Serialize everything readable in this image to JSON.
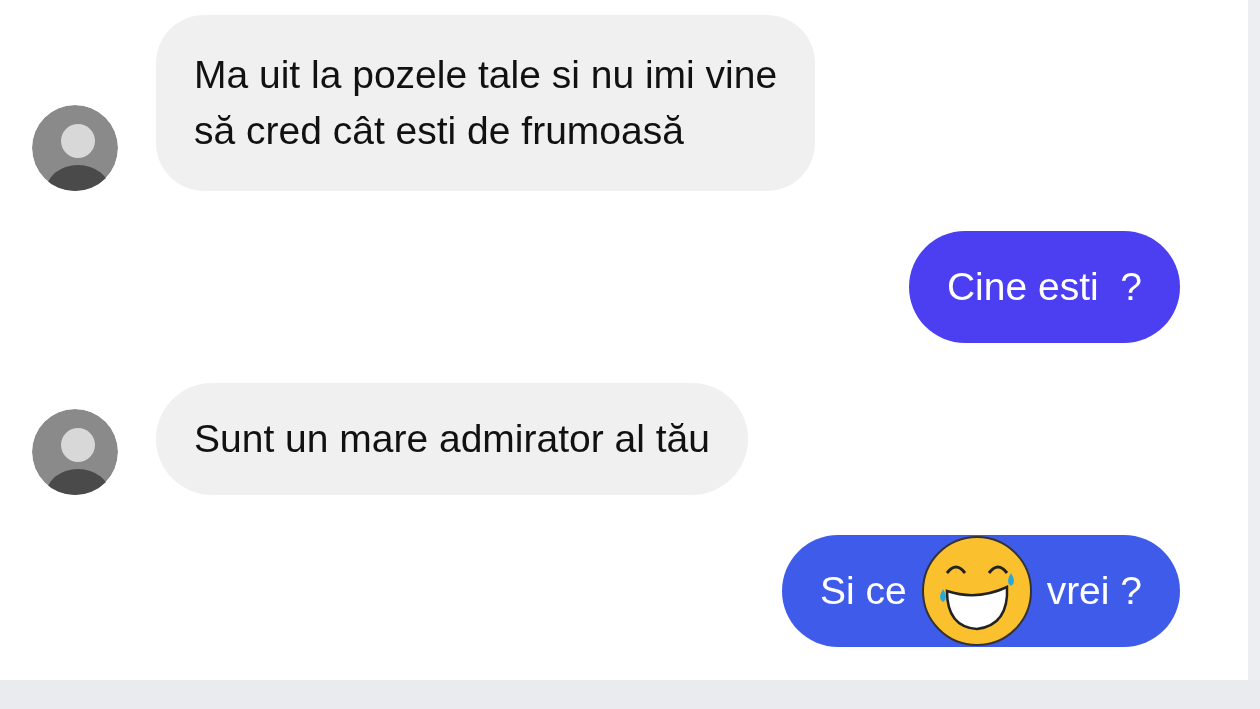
{
  "messages": [
    {
      "kind": "incoming",
      "lines": [
        "Ma uit la pozele tale si nu imi vine",
        "să cred cât esti de frumoasă"
      ]
    },
    {
      "kind": "outgoing",
      "lines": [
        "Cine esti  ?"
      ],
      "color": "#4b3ff1"
    },
    {
      "kind": "incoming",
      "lines": [
        "Sunt un mare admirator al tău"
      ]
    },
    {
      "kind": "outgoing-covered",
      "parts": [
        "Si ce",
        "vrei ?"
      ],
      "color": "#3e5ce9"
    }
  ]
}
